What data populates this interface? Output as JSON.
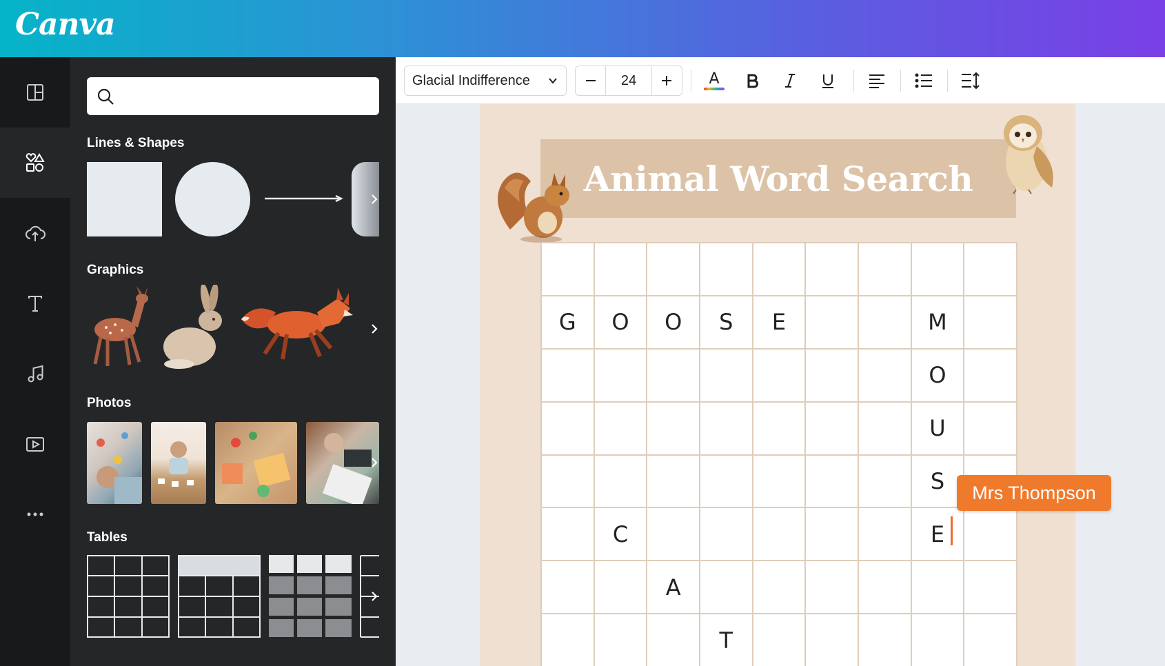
{
  "app": {
    "logo": "Canva"
  },
  "rail": {
    "items": [
      {
        "icon": "layout-icon"
      },
      {
        "icon": "elements-icon",
        "active": true
      },
      {
        "icon": "upload-cloud-icon"
      },
      {
        "icon": "text-icon"
      },
      {
        "icon": "music-icon"
      },
      {
        "icon": "video-icon"
      },
      {
        "icon": "more-icon"
      }
    ]
  },
  "panel": {
    "search": {
      "value": "",
      "placeholder": ""
    },
    "sections": {
      "shapes": "Lines & Shapes",
      "graphics": "Graphics",
      "photos": "Photos",
      "tables": "Tables"
    }
  },
  "toolbar": {
    "font": "Glacial Indifference",
    "font_size": "24",
    "text_color_icon": "A"
  },
  "design": {
    "title": "Animal Word Search",
    "grid": [
      [
        "",
        "",
        "",
        "",
        "",
        "",
        "",
        "",
        ""
      ],
      [
        "G",
        "O",
        "O",
        "S",
        "E",
        "",
        "",
        "M",
        ""
      ],
      [
        "",
        "",
        "",
        "",
        "",
        "",
        "",
        "O",
        ""
      ],
      [
        "",
        "",
        "",
        "",
        "",
        "",
        "",
        "U",
        ""
      ],
      [
        "",
        "",
        "",
        "",
        "",
        "",
        "",
        "S",
        ""
      ],
      [
        "",
        "C",
        "",
        "",
        "",
        "",
        "",
        "E",
        ""
      ],
      [
        "",
        "",
        "A",
        "",
        "",
        "",
        "",
        "",
        ""
      ],
      [
        "",
        "",
        "",
        "T",
        "",
        "",
        "",
        "",
        ""
      ]
    ]
  },
  "collaborator": {
    "name": "Mrs Thompson",
    "color": "#f07a2c"
  }
}
